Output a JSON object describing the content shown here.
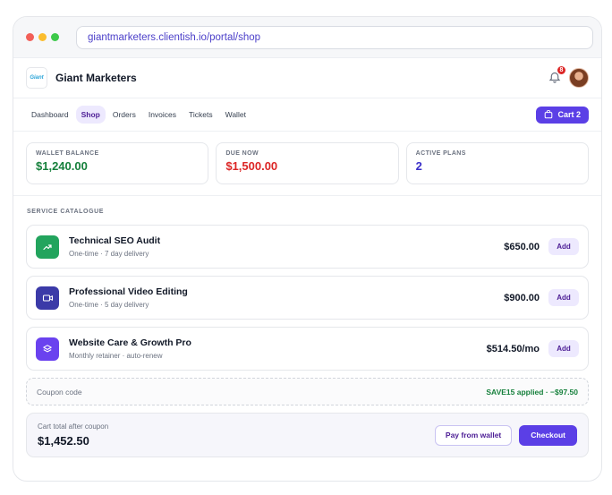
{
  "browser": {
    "url": "giantmarketers.clientish.io/portal/shop",
    "dots": [
      "#f25f58",
      "#fbbd2e",
      "#3dc94a"
    ]
  },
  "header": {
    "logo_text": "Giant",
    "brand": "Giant Marketers",
    "notification_count": "8"
  },
  "nav": {
    "items": [
      {
        "label": "Dashboard",
        "active": false
      },
      {
        "label": "Shop",
        "active": true
      },
      {
        "label": "Orders",
        "active": false
      },
      {
        "label": "Invoices",
        "active": false
      },
      {
        "label": "Tickets",
        "active": false
      },
      {
        "label": "Wallet",
        "active": false
      }
    ],
    "cart_label": "Cart 2"
  },
  "stats": [
    {
      "label": "WALLET BALANCE",
      "value": "$1,240.00",
      "color": "#16803c"
    },
    {
      "label": "DUE NOW",
      "value": "$1,500.00",
      "color": "#dc2626"
    },
    {
      "label": "ACTIVE PLANS",
      "value": "2",
      "color": "#3b2fc9"
    }
  ],
  "catalogue": {
    "label": "SERVICE CATALOGUE",
    "items": [
      {
        "title": "Technical SEO Audit",
        "subtitle": "One-time · 7 day delivery",
        "price": "$650.00",
        "add_label": "Add",
        "icon": "trending-up-icon",
        "icon_bg": "#22a45d"
      },
      {
        "title": "Professional Video Editing",
        "subtitle": "One-time · 5 day delivery",
        "price": "$900.00",
        "add_label": "Add",
        "icon": "video-icon",
        "icon_bg": "#3b3aa8"
      },
      {
        "title": "Website Care & Growth Pro",
        "subtitle": "Monthly retainer · auto-renew",
        "price": "$514.50/mo",
        "add_label": "Add",
        "icon": "layers-icon",
        "icon_bg": "#6a42ef"
      }
    ]
  },
  "coupon": {
    "placeholder": "Coupon code",
    "applied": "SAVE15 applied · −$97.50"
  },
  "total": {
    "label": "Cart total after coupon",
    "value": "$1,452.50",
    "pay_wallet_label": "Pay from wallet",
    "checkout_label": "Checkout"
  }
}
